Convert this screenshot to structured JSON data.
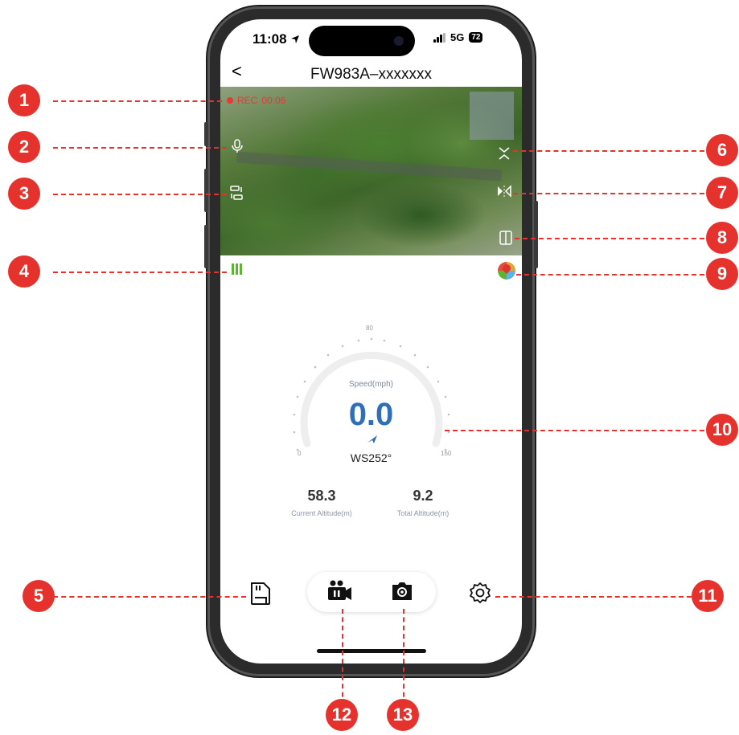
{
  "status_bar": {
    "time": "11:08",
    "network": "5G",
    "battery": "72"
  },
  "header": {
    "back_label": "<",
    "title": "FW983A–xxxxxxx"
  },
  "camera_view": {
    "rec_label": "REC",
    "rec_time": "00:06"
  },
  "gauge": {
    "label": "Speed(mph)",
    "speed": "0.0",
    "heading": "WS252°",
    "tick_min": "0",
    "tick_mid": "80",
    "tick_max": "160"
  },
  "altitude": {
    "current_value": "58.3",
    "current_label": "Current Altitude(m)",
    "total_value": "9.2",
    "total_label": "Total Altitude(m)"
  },
  "callouts": [
    "1",
    "2",
    "3",
    "4",
    "5",
    "6",
    "7",
    "8",
    "9",
    "10",
    "11",
    "12",
    "13"
  ],
  "colors": {
    "callout": "#e5322d",
    "accent": "#2f6fb8",
    "signal_green": "#5cb531",
    "rec_red": "#e53935"
  }
}
